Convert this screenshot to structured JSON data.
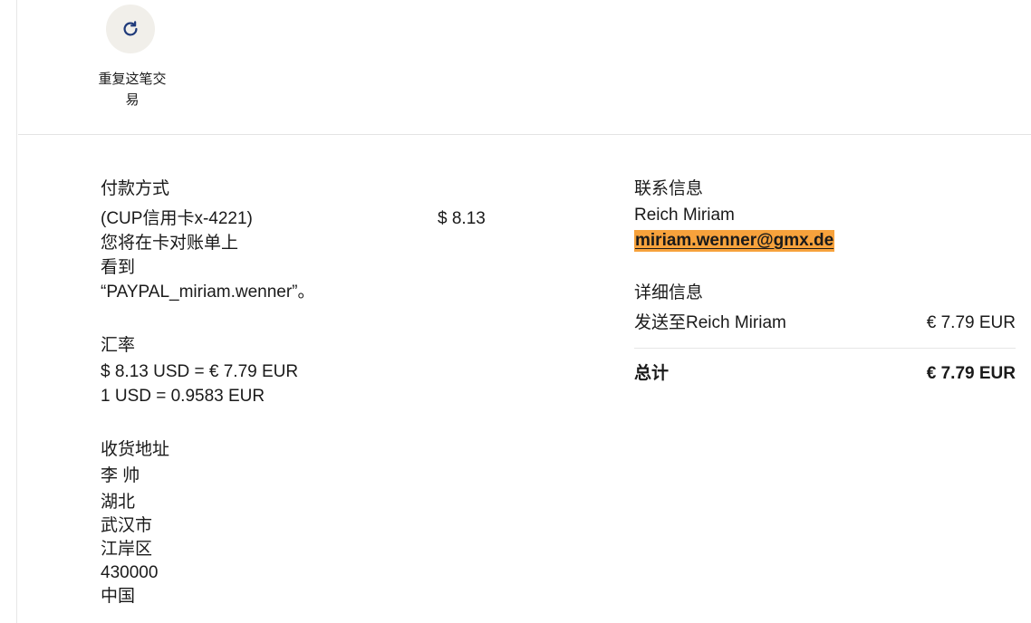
{
  "repeat": {
    "label_line1": "重复这笔交",
    "label_line2": "易"
  },
  "payment": {
    "title": "付款方式",
    "method": "(CUP信用卡x-4221)",
    "amount": "$ 8.13",
    "statement_lines": [
      "您将在卡对账单上",
      "看到",
      "“PAYPAL_miriam.wenner”。"
    ]
  },
  "exchange": {
    "title": "汇率",
    "line1": "$ 8.13 USD = € 7.79 EUR",
    "line2": "1 USD = 0.9583 EUR"
  },
  "shipping": {
    "title": "收货地址",
    "lines": [
      "李 帅",
      "湖北",
      "武汉市",
      "江岸区",
      "430000",
      "中国"
    ]
  },
  "contact": {
    "title": "联系信息",
    "name": "Reich Miriam",
    "email": "miriam.wenner@gmx.de"
  },
  "details": {
    "title": "详细信息",
    "item_label": "发送至Reich Miriam",
    "item_amount": "€ 7.79 EUR",
    "total_label": "总计",
    "total_amount": "€ 7.79 EUR"
  },
  "colors": {
    "email_highlight": "#f7a23c",
    "icon": "#1f3a7a",
    "button_bg": "#f1efea"
  }
}
